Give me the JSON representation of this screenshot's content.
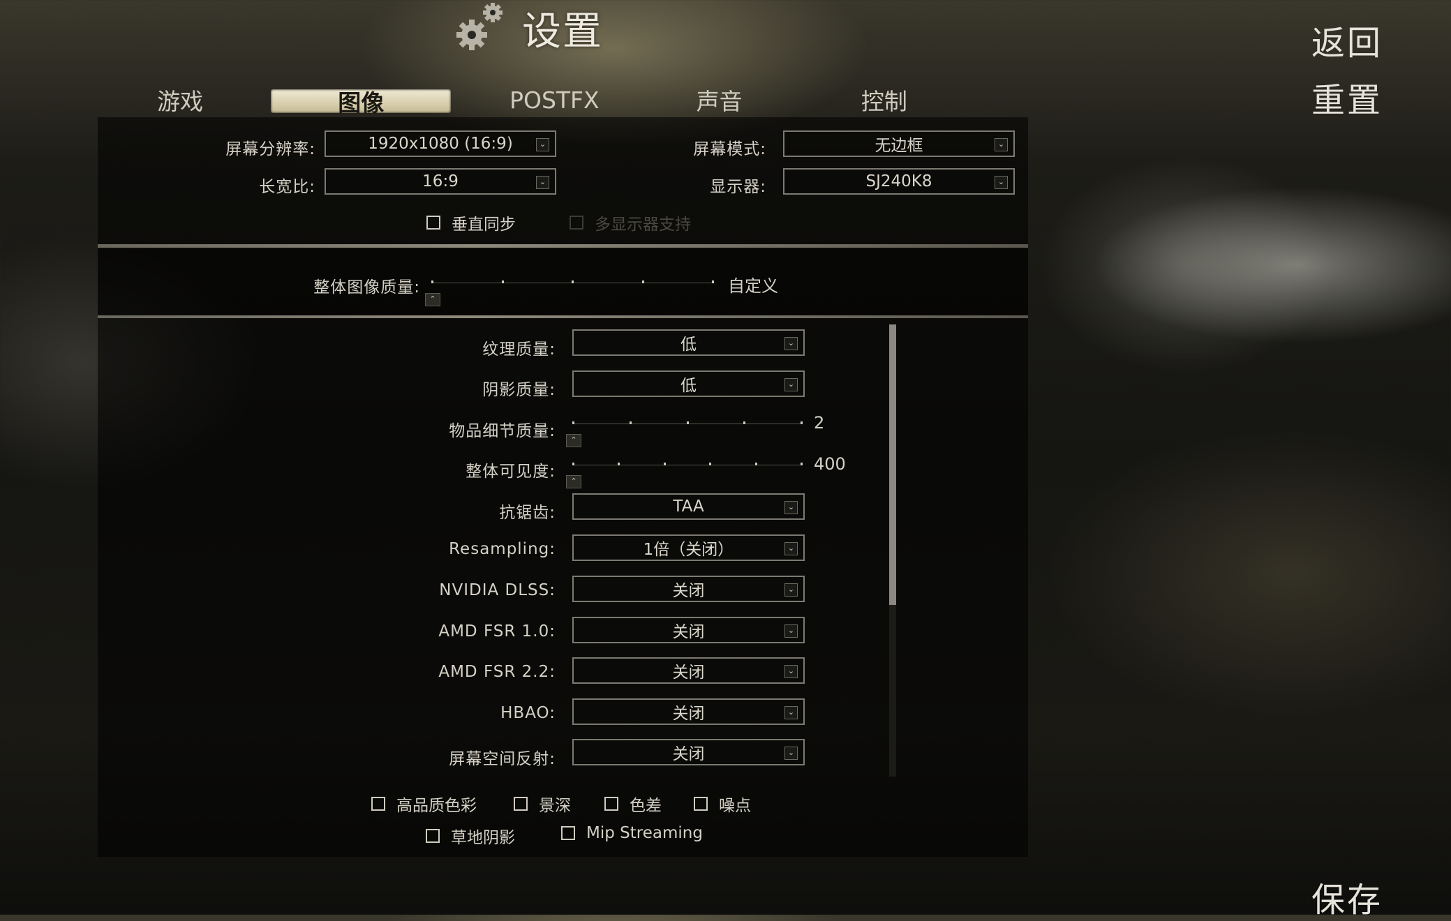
{
  "header": {
    "title": "设置",
    "back_label": "返回",
    "reset_label": "重置",
    "save_label": "保存"
  },
  "tabs": [
    {
      "label": "游戏"
    },
    {
      "label": "图像",
      "active": true
    },
    {
      "label": "POSTFX"
    },
    {
      "label": "声音"
    },
    {
      "label": "控制"
    }
  ],
  "display": {
    "resolution_label": "屏幕分辨率:",
    "resolution_value": "1920x1080 (16:9)",
    "screen_mode_label": "屏幕模式:",
    "screen_mode_value": "无边框",
    "aspect_label": "长宽比:",
    "aspect_value": "16:9",
    "monitor_label": "显示器:",
    "monitor_value": "SJ240K8",
    "vsync_label": "垂直同步",
    "vsync_checked": false,
    "multimonitor_label": "多显示器支持",
    "multimonitor_enabled": false
  },
  "overall_quality": {
    "label": "整体图像质量:",
    "value": "自定义",
    "steps": 5
  },
  "settings": {
    "texture_label": "纹理质量:",
    "texture_value": "低",
    "shadow_label": "阴影质量:",
    "shadow_value": "低",
    "object_lod_label": "物品细节质量:",
    "object_lod_value": "2",
    "object_lod_steps": 5,
    "visibility_label": "整体可见度:",
    "visibility_value": "400",
    "visibility_steps": 6,
    "antialias_label": "抗锯齿:",
    "antialias_value": "TAA",
    "resampling_label": "Resampling:",
    "resampling_value": "1倍（关闭）",
    "dlss_label": "NVIDIA DLSS:",
    "dlss_value": "关闭",
    "fsr1_label": "AMD FSR 1.0:",
    "fsr1_value": "关闭",
    "fsr2_label": "AMD FSR 2.2:",
    "fsr2_value": "关闭",
    "hbao_label": "HBAO:",
    "hbao_value": "关闭",
    "ssr_label": "屏幕空间反射:",
    "ssr_value": "关闭"
  },
  "toggles": {
    "hq_color_label": "高品质色彩",
    "dof_label": "景深",
    "chromatic_label": "色差",
    "noise_label": "噪点",
    "grass_shadow_label": "草地阴影",
    "mip_streaming_label": "Mip Streaming"
  },
  "scrollbar": {
    "position": 0.0,
    "visible_fraction": 0.62
  },
  "icons": [
    "gear-icon",
    "chevron-down-icon",
    "chevron-up-icon"
  ]
}
